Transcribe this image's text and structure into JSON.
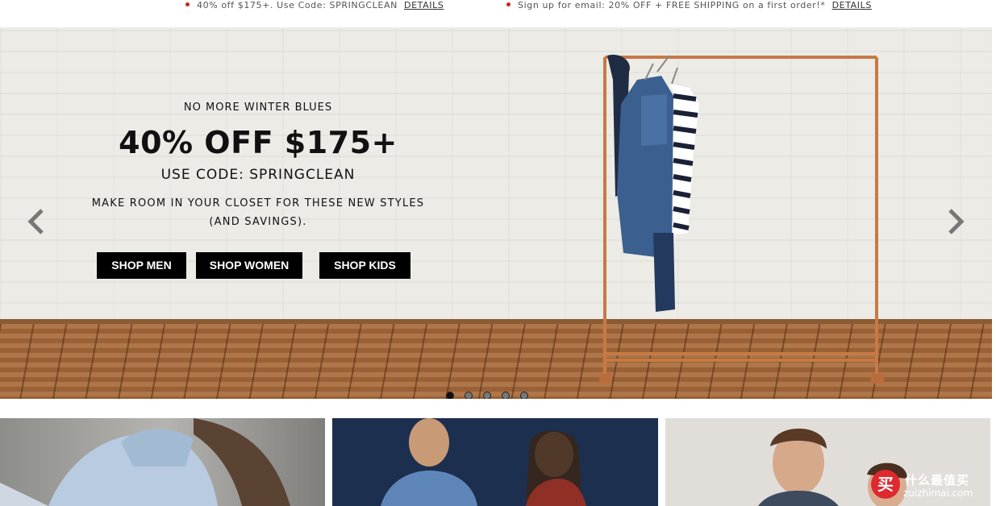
{
  "colors": {
    "accent": "#c8231f",
    "cta_bg": "#000000",
    "cta_text": "#ffffff"
  },
  "promo_bar": {
    "items": [
      {
        "text": "40% off $175+. Use Code: SPRINGCLEAN",
        "link": "DETAILS",
        "bullet_color": "#c8231f"
      },
      {
        "text": "Sign up for email: 20% OFF + FREE SHIPPING on a first order!*",
        "link": "DETAILS",
        "bullet_color": "#c8231f"
      }
    ]
  },
  "hero": {
    "eyebrow": "NO MORE WINTER BLUES",
    "headline": "40% OFF $175+",
    "code": "USE CODE: SPRINGCLEAN",
    "description_line1": "MAKE ROOM IN YOUR CLOSET FOR THESE NEW STYLES",
    "description_line2": "(AND SAVINGS).",
    "buttons": [
      "SHOP MEN",
      "SHOP WOMEN",
      "SHOP KIDS"
    ],
    "prev_icon": "chevron-left-icon",
    "next_icon": "chevron-right-icon",
    "carousel": {
      "slide_count": 5,
      "active_index": 0
    }
  },
  "watermark": {
    "badge": "买",
    "name": "什么最值买",
    "url": "zuizhimai.com"
  }
}
